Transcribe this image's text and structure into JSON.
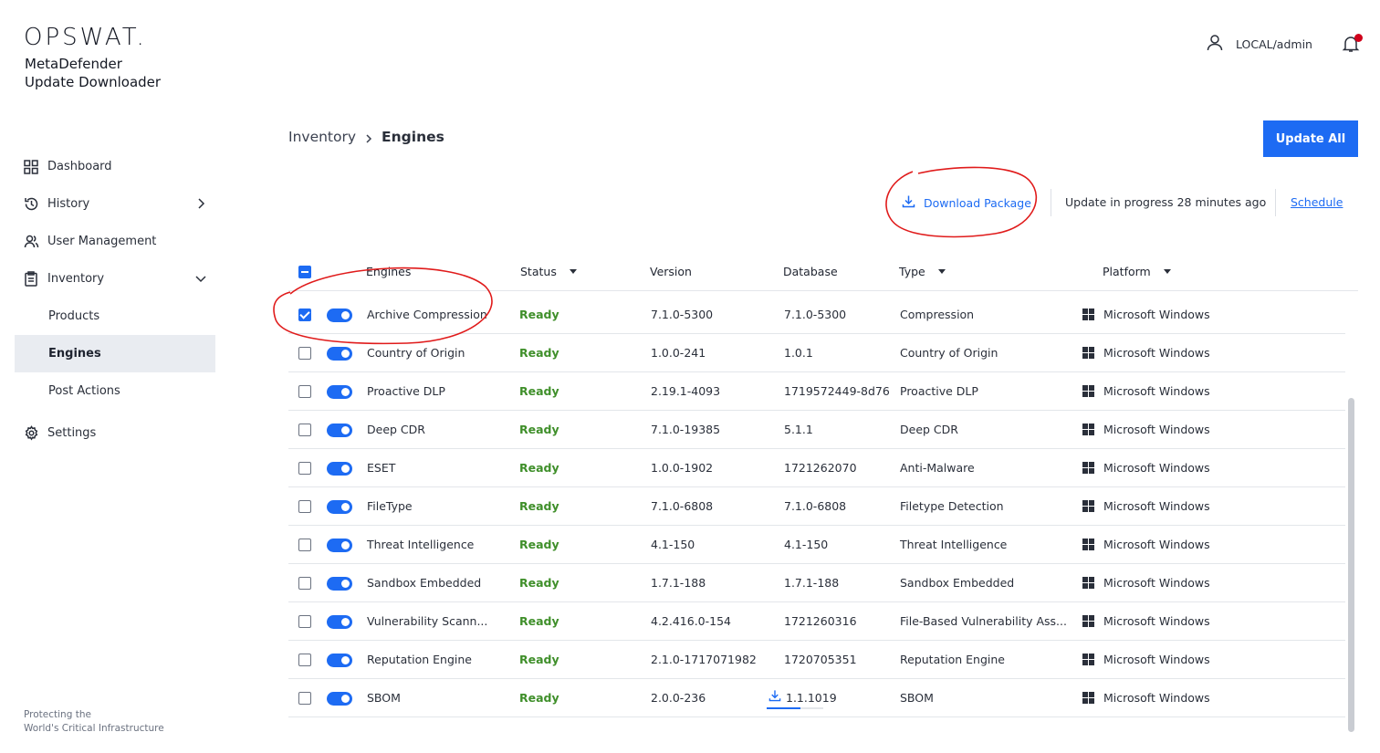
{
  "brand": {
    "logo": "OPSWAT.",
    "product_line1": "MetaDefender",
    "product_line2": "Update Downloader",
    "tagline_line1": "Protecting the",
    "tagline_line2": "World's Critical Infrastructure"
  },
  "user": {
    "name": "LOCAL/admin"
  },
  "sidebar": {
    "items": [
      {
        "label": "Dashboard",
        "icon": "grid-icon"
      },
      {
        "label": "History",
        "icon": "history-icon"
      },
      {
        "label": "User Management",
        "icon": "users-icon"
      },
      {
        "label": "Inventory",
        "icon": "clipboard-icon"
      },
      {
        "label": "Settings",
        "icon": "gear-icon"
      }
    ],
    "inventory_children": [
      {
        "label": "Products"
      },
      {
        "label": "Engines"
      },
      {
        "label": "Post Actions"
      }
    ]
  },
  "breadcrumb": {
    "parent": "Inventory",
    "current": "Engines"
  },
  "actions": {
    "update_all": "Update All",
    "download_package": "Download Package",
    "progress_label": "Update in progress",
    "progress_time": "28 minutes ago",
    "schedule": "Schedule"
  },
  "table": {
    "columns": [
      "Engines",
      "Status",
      "Version",
      "Database",
      "Type",
      "Platform"
    ],
    "rows": [
      {
        "name": "Archive Compression",
        "status": "Ready",
        "version": "7.1.0-5300",
        "database": "7.1.0-5300",
        "type": "Compression",
        "platform": "Microsoft Windows",
        "checked": true
      },
      {
        "name": "Country of Origin",
        "status": "Ready",
        "version": "1.0.0-241",
        "database": "1.0.1",
        "type": "Country of Origin",
        "platform": "Microsoft Windows",
        "checked": false
      },
      {
        "name": "Proactive DLP",
        "status": "Ready",
        "version": "2.19.1-4093",
        "database": "1719572449-8d76",
        "type": "Proactive DLP",
        "platform": "Microsoft Windows",
        "checked": false
      },
      {
        "name": "Deep CDR",
        "status": "Ready",
        "version": "7.1.0-19385",
        "database": "5.1.1",
        "type": "Deep CDR",
        "platform": "Microsoft Windows",
        "checked": false
      },
      {
        "name": "ESET",
        "status": "Ready",
        "version": "1.0.0-1902",
        "database": "1721262070",
        "type": "Anti-Malware",
        "platform": "Microsoft Windows",
        "checked": false
      },
      {
        "name": "FileType",
        "status": "Ready",
        "version": "7.1.0-6808",
        "database": "7.1.0-6808",
        "type": "Filetype Detection",
        "platform": "Microsoft Windows",
        "checked": false
      },
      {
        "name": "Threat Intelligence",
        "status": "Ready",
        "version": "4.1-150",
        "database": "4.1-150",
        "type": "Threat Intelligence",
        "platform": "Microsoft Windows",
        "checked": false
      },
      {
        "name": "Sandbox Embedded",
        "status": "Ready",
        "version": "1.7.1-188",
        "database": "1.7.1-188",
        "type": "Sandbox Embedded",
        "platform": "Microsoft Windows",
        "checked": false
      },
      {
        "name": "Vulnerability Scann...",
        "status": "Ready",
        "version": "4.2.416.0-154",
        "database": "1721260316",
        "type": "File-Based Vulnerability Ass...",
        "platform": "Microsoft Windows",
        "checked": false
      },
      {
        "name": "Reputation Engine",
        "status": "Ready",
        "version": "2.1.0-1717071982",
        "database": "1720705351",
        "type": "Reputation Engine",
        "platform": "Microsoft Windows",
        "checked": false
      },
      {
        "name": "SBOM",
        "status": "Ready",
        "version": "2.0.0-236",
        "database": "1.1.1019",
        "type": "SBOM",
        "platform": "Microsoft Windows",
        "checked": false,
        "database_downloading": true,
        "database_progress": 0.6
      }
    ]
  },
  "colors": {
    "accent": "#1d6bf3",
    "ready": "#3f8f2a",
    "annotation": "#e01b1b",
    "notification": "#d0021b"
  }
}
